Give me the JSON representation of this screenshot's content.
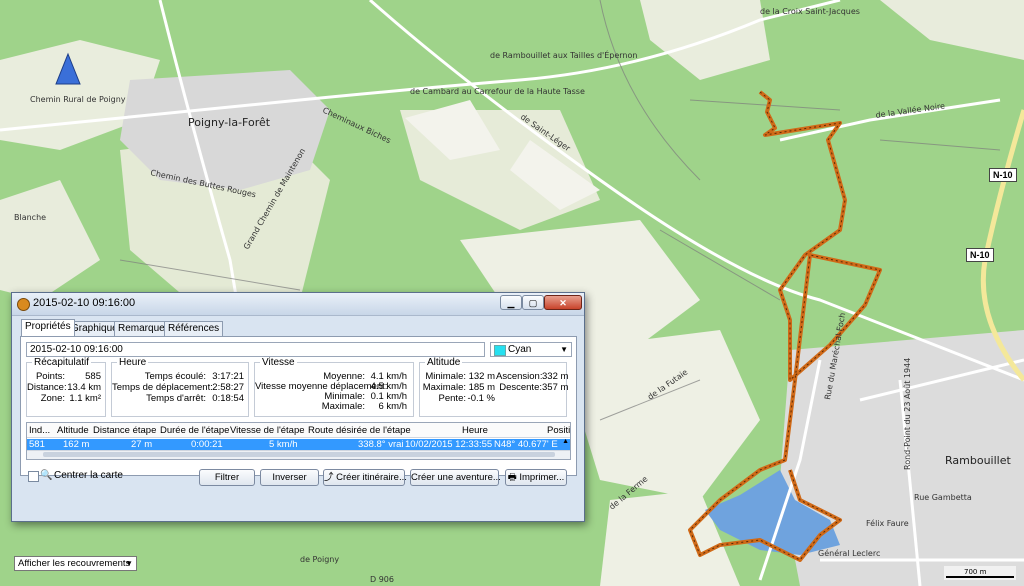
{
  "map": {
    "labels": {
      "poigny": "Poigny-la-Forêt",
      "rambouillet": "Rambouillet",
      "chemin_rural": "Chemin Rural de Poigny",
      "chemin_butte": "Chemin des Buttes Rouges",
      "grand_chemin": "Grand Chemin de Maintenon",
      "cheminaux": "Cheminaux Biches",
      "cambard": "de Cambard au Carrefour de la Haute Tasse",
      "rambouillet_tailles": "de Rambouillet aux Tailles d'Épernon",
      "croix": "de la Croix Saint-Jacques",
      "vallee": "de la Vallée Noire",
      "saint_leger": "de Saint-Léger",
      "blanche": "Blanche",
      "rouge": "des Rouges",
      "gambetta": "Rue Gambetta",
      "foch": "Rue du Maréchal Foch",
      "faure": "Félix Faure",
      "leclerc": "Général Leclerc",
      "rond_point": "Rond-Point du 23 Août 1944",
      "poigny_road": "de Poigny",
      "d906": "D 906",
      "futaie": "de la Futaie",
      "ferme": "de la Ferme"
    },
    "roads": {
      "n10_top": "N-10",
      "n10_mid": "N-10"
    },
    "scale": "700 m",
    "accent_track": "#d06a18",
    "water": "#6fa3de"
  },
  "dialog": {
    "title": "2015-02-10 09:16:00",
    "tabs": [
      "Propriétés",
      "Graphique",
      "Remarques",
      "Références"
    ],
    "name_value": "2015-02-10 09:16:00",
    "color_value": "Cyan",
    "groups": {
      "recap": {
        "title": "Récapitulatif",
        "rows": [
          {
            "label": "Points:",
            "value": "585"
          },
          {
            "label": "Distance:",
            "value": "13.4 km"
          },
          {
            "label": "Zone:",
            "value": "1.1 km²"
          }
        ]
      },
      "heure": {
        "title": "Heure",
        "rows": [
          {
            "label": "Temps écoulé:",
            "value": "3:17:21"
          },
          {
            "label": "Temps de déplacement:",
            "value": "2:58:27"
          },
          {
            "label": "Temps d'arrêt:",
            "value": "0:18:54"
          }
        ]
      },
      "vitesse": {
        "title": "Vitesse",
        "rows": [
          {
            "label": "Moyenne:",
            "value": "4.1 km/h"
          },
          {
            "label": "Vitesse moyenne déplacement:",
            "value": "4.5 km/h"
          },
          {
            "label": "Minimale:",
            "value": "0.1 km/h"
          },
          {
            "label": "Maximale:",
            "value": "6 km/h"
          }
        ]
      },
      "altitude": {
        "title": "Altitude",
        "rows": [
          {
            "label": "Minimale:",
            "value": "132 m",
            "label2": "Ascension:",
            "value2": "332 m"
          },
          {
            "label": "Maximale:",
            "value": "185 m",
            "label2": "Descente:",
            "value2": "357 m"
          },
          {
            "label": "Pente:",
            "value": "-0.1 %"
          }
        ]
      }
    },
    "table": {
      "headers": [
        "Ind...",
        "Altitude",
        "Distance étape",
        "Durée de l'étape",
        "Vitesse de l'étape",
        "Route désirée de l'étape",
        "Heure",
        "Position"
      ],
      "row": [
        "581",
        "162 m",
        "27 m",
        "0:00:21",
        "5 km/h",
        "338.8° vrai",
        "10/02/2015 12:33:55",
        "N48° 40.677' E"
      ]
    },
    "center_label": "Centrer la carte",
    "buttons": {
      "filter": "Filtrer",
      "reverse": "Inverser",
      "create_route": "Créer itinéraire...",
      "create_adventure": "Créer une aventure...",
      "print": "Imprimer..."
    }
  },
  "overlay_select": "Afficher les recouvrements"
}
